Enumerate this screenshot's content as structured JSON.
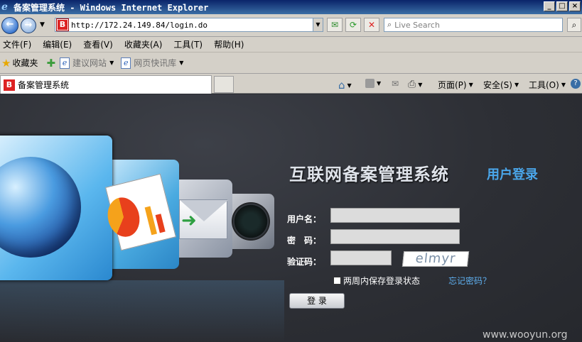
{
  "window": {
    "title": "备案管理系统 - Windows Internet Explorer",
    "controls": [
      "_",
      "□",
      "×"
    ]
  },
  "navbar": {
    "back_icon": "back-arrow-icon",
    "forward_icon": "forward-arrow-icon",
    "address_icon_letter": "B",
    "address": "http://172.24.149.84/login.do",
    "search_placeholder": "Live Search",
    "compat_icon": "compatibility-view-icon",
    "refresh_icon": "refresh-icon",
    "stop_icon": "stop-icon",
    "search_icon": "search-icon"
  },
  "menubar": {
    "items": [
      "文件(F)",
      "编辑(E)",
      "查看(V)",
      "收藏夹(A)",
      "工具(T)",
      "帮助(H)"
    ]
  },
  "favbar": {
    "favorites_label": "收藏夹",
    "links": [
      "建议网站",
      "网页快讯库"
    ]
  },
  "tabbar": {
    "tab_title": "备案管理系统",
    "tab_icon_letter": "B",
    "commands": [
      "页面(P)",
      "安全(S)",
      "工具(O)"
    ]
  },
  "login": {
    "system_title": "互联网备案管理系统",
    "subtitle": "用户登录",
    "username_label": "用户名：",
    "password_label": "密　码：",
    "captcha_label": "验证码：",
    "captcha_text": "elmyr",
    "remember_label": "两周内保存登录状态",
    "forgot_link": "忘记密码？",
    "submit_label": "登 录"
  },
  "watermark": "www.wooyun.org"
}
